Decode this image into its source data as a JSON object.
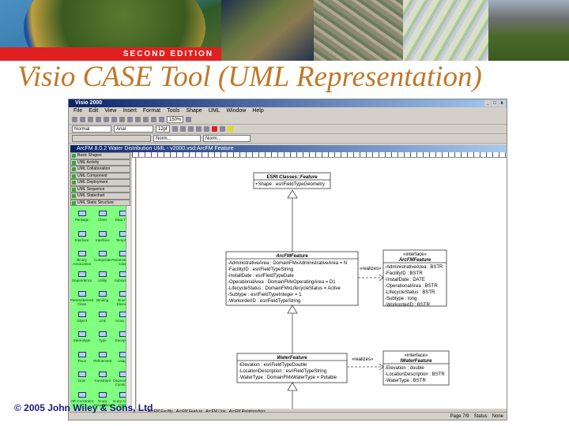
{
  "banner": {
    "edition": "SECOND EDITION"
  },
  "slide": {
    "title": "Visio CASE Tool (UML Representation)",
    "copyright": "© 2005 John Wiley & Sons, Ltd"
  },
  "app": {
    "title": "Visio 2000",
    "menu": [
      "File",
      "Edit",
      "View",
      "Insert",
      "Format",
      "Tools",
      "Shape",
      "UML",
      "Window",
      "Help"
    ],
    "zoom": "150%",
    "style": "Normal",
    "font": "Arial",
    "size": "12pt",
    "line1": "Norm...",
    "line2": "Norm...",
    "doc_title": "ArcFM 8.0.2 Water Distribution UML - v2000.vsd:ArcFM Feature"
  },
  "stencil": {
    "headers": [
      "Basic Shapes",
      "UML Activity",
      "UML Collaboration",
      "UML Component",
      "UML Deployment",
      "UML Sequence",
      "UML Statechart",
      "UML Static Structure"
    ],
    "shapes": [
      "Package",
      "Class",
      "Data Type",
      "Interface",
      "Interface",
      "Template",
      "Binary Association",
      "Composite",
      "Parameterized Class",
      "Dependency",
      "Utility",
      "Subsystem",
      "Parameterized Class",
      "Binding",
      "Bound Element",
      "Object",
      "Link",
      "N-ary link",
      "Stereotype",
      "Type",
      "Exception",
      "Trace",
      "Refinement",
      "Usage",
      "Note",
      "Constraint",
      "Dependency Constraint",
      "OR Constraint",
      "N-ary Association",
      "N-ary Assoc. Class"
    ]
  },
  "diagram": {
    "feature": {
      "name": "ESRI Classes::Feature",
      "attrs": [
        "+Shape : esriFieldTypeGeometry"
      ]
    },
    "arcfm": {
      "name": "ArcFMFeature",
      "attrs": [
        "-AdministrativeArea : DomainFMxAdministrativeArea = N",
        "-FacilityID : esriFieldTypeString",
        "-InstallDate : esriFieldTypeDate",
        "-OperationalArea : DomainFMxOperatingArea = D1",
        "-LifecycleStatus : DomainFMxLifecycleStatus = Active",
        "-Subtype : esriFieldTypeInteger = 1",
        "-WorkorderID : esriFieldTypeString"
      ]
    },
    "iarcfm": {
      "stereotype": "«interface»",
      "name": "ArcFMFeature",
      "attrs": [
        "-AdministrativeArea : BSTR",
        "-FacilityID : BSTR",
        "-InstallDate : DATE",
        "-OperationalArea : BSTR",
        "-LifecycleStatus : BSTR",
        "-Subtype : long",
        "-WorkorderID : BSTR"
      ]
    },
    "water": {
      "name": "WaterFeature",
      "attrs": [
        "-Elevation : esriFieldTypeDouble",
        "-LocationDescription : esriFieldTypeString",
        "-WaterType : DomainFMxWaterType = Potable"
      ]
    },
    "iwater": {
      "stereotype": "«interface»",
      "name": "IWaterFeature",
      "attrs": [
        "-Elevation : double",
        "-LocationDescription : BSTR",
        "-WaterType : BSTR"
      ]
    },
    "realizes": "«realizes»"
  },
  "tabs": [
    "ArcFM Facility",
    "ArcFM Feature",
    "ArcFM Line",
    "ArcFM Relationships"
  ],
  "status": [
    "Page 7/9",
    "Status",
    "None"
  ]
}
